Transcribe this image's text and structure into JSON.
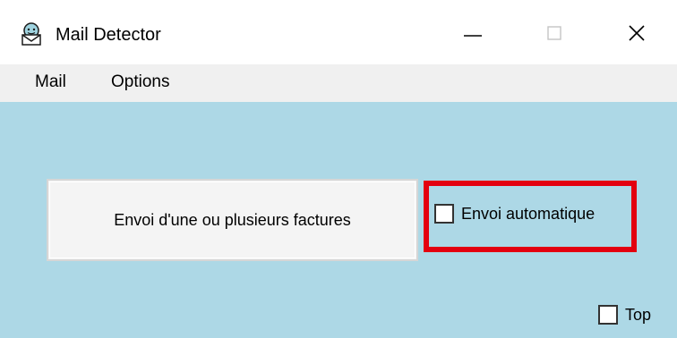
{
  "window": {
    "title": "Mail Detector",
    "icon": "mail-detector-icon",
    "controls": {
      "minimize": "minimize-icon",
      "maximize": "maximize-icon",
      "close": "close-icon"
    }
  },
  "menu": {
    "items": [
      {
        "label": "Mail"
      },
      {
        "label": "Options"
      }
    ]
  },
  "main": {
    "send_button_label": "Envoi d'une ou plusieurs factures",
    "auto_send": {
      "label": "Envoi automatique",
      "checked": false
    },
    "top": {
      "label": "Top",
      "checked": false
    }
  },
  "colors": {
    "client_background": "#add8e6",
    "highlight": "#e3000f",
    "menubar": "#f0f0f0"
  }
}
